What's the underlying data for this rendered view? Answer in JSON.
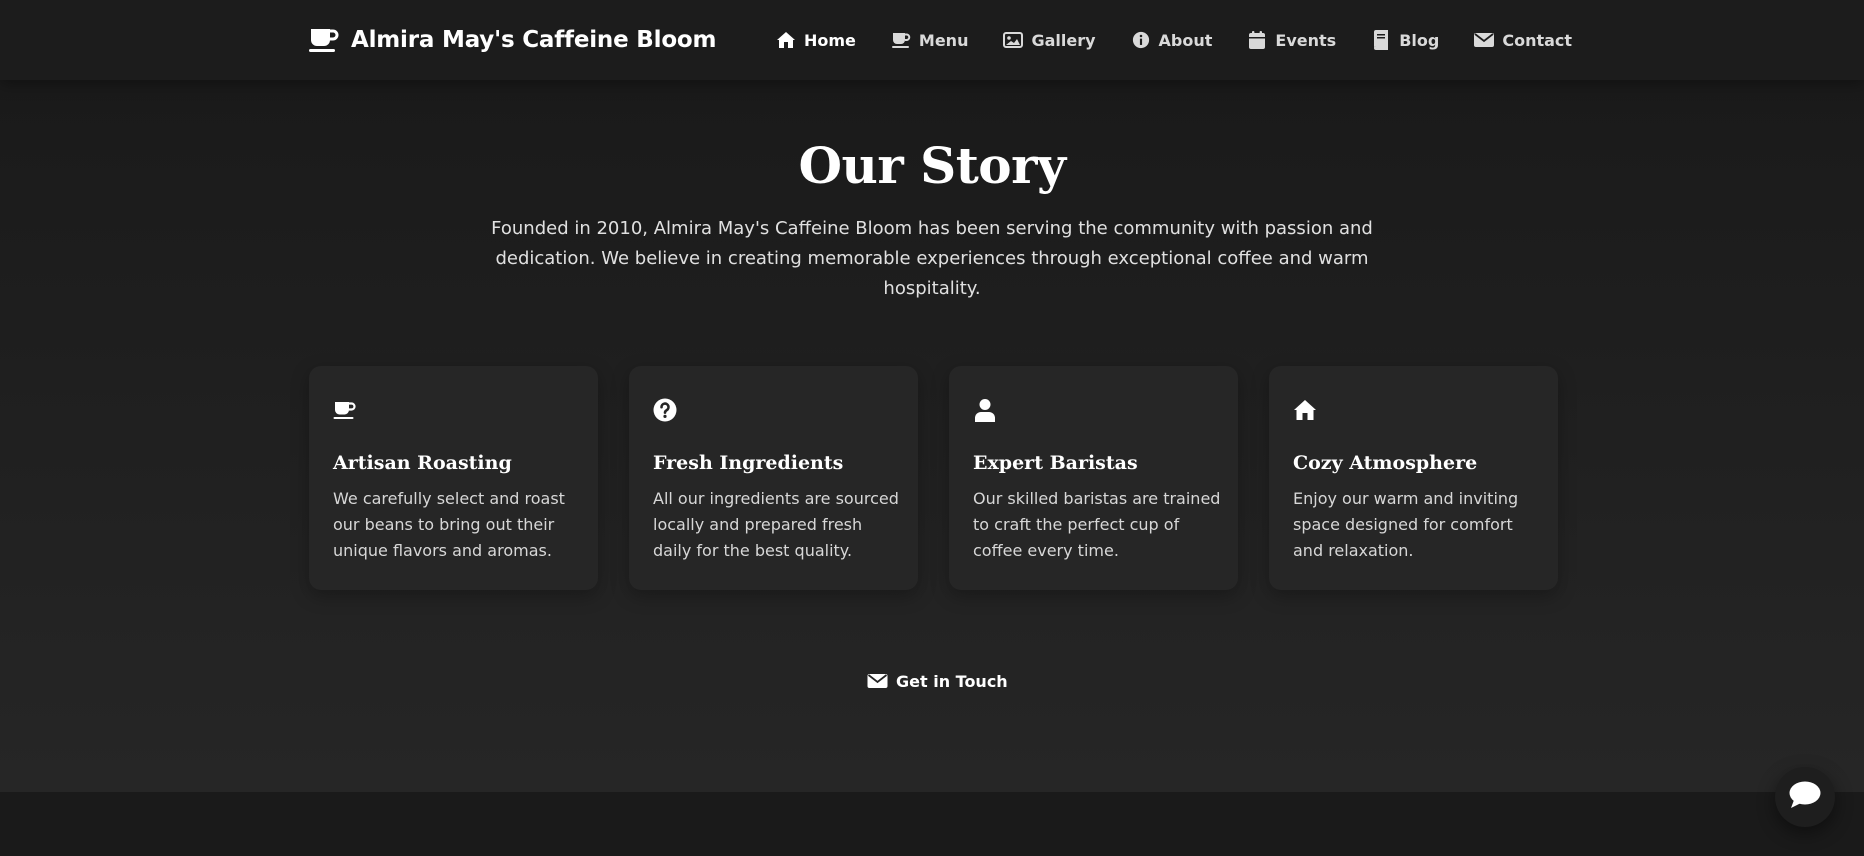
{
  "header": {
    "brand_name": "Almira May's Caffeine Bloom",
    "brand_icon": "coffee-cup-icon",
    "nav": [
      {
        "label": "Home",
        "icon": "home-icon",
        "active": true
      },
      {
        "label": "Menu",
        "icon": "coffee-cup-icon",
        "active": false
      },
      {
        "label": "Gallery",
        "icon": "image-icon",
        "active": false
      },
      {
        "label": "About",
        "icon": "info-icon",
        "active": false
      },
      {
        "label": "Events",
        "icon": "calendar-icon",
        "active": false
      },
      {
        "label": "Blog",
        "icon": "book-icon",
        "active": false
      },
      {
        "label": "Contact",
        "icon": "envelope-icon",
        "active": false
      }
    ]
  },
  "main": {
    "title": "Our Story",
    "intro": "Founded in 2010, Almira May's Caffeine Bloom has been serving the community with passion and dedication. We believe in creating memorable experiences through exceptional coffee and warm hospitality.",
    "features": [
      {
        "icon": "coffee-cup-icon",
        "title": "Artisan Roasting",
        "text": "We carefully select and roast our beans to bring out their unique flavors and aromas."
      },
      {
        "icon": "question-circle-icon",
        "title": "Fresh Ingredients",
        "text": "All our ingredients are sourced locally and prepared fresh daily for the best quality."
      },
      {
        "icon": "user-icon",
        "title": "Expert Baristas",
        "text": "Our skilled baristas are trained to craft the perfect cup of coffee every time."
      },
      {
        "icon": "home-icon",
        "title": "Cozy Atmosphere",
        "text": "Enjoy our warm and inviting space designed for comfort and relaxation."
      }
    ],
    "cta": {
      "label": "Get in Touch",
      "icon": "envelope-icon"
    }
  },
  "chat": {
    "icon": "chat-bubble-icon"
  },
  "colors": {
    "background": "#1a1a1a",
    "card": "#262626",
    "text": "#ffffff",
    "muted_text": "#d7d7d7"
  }
}
